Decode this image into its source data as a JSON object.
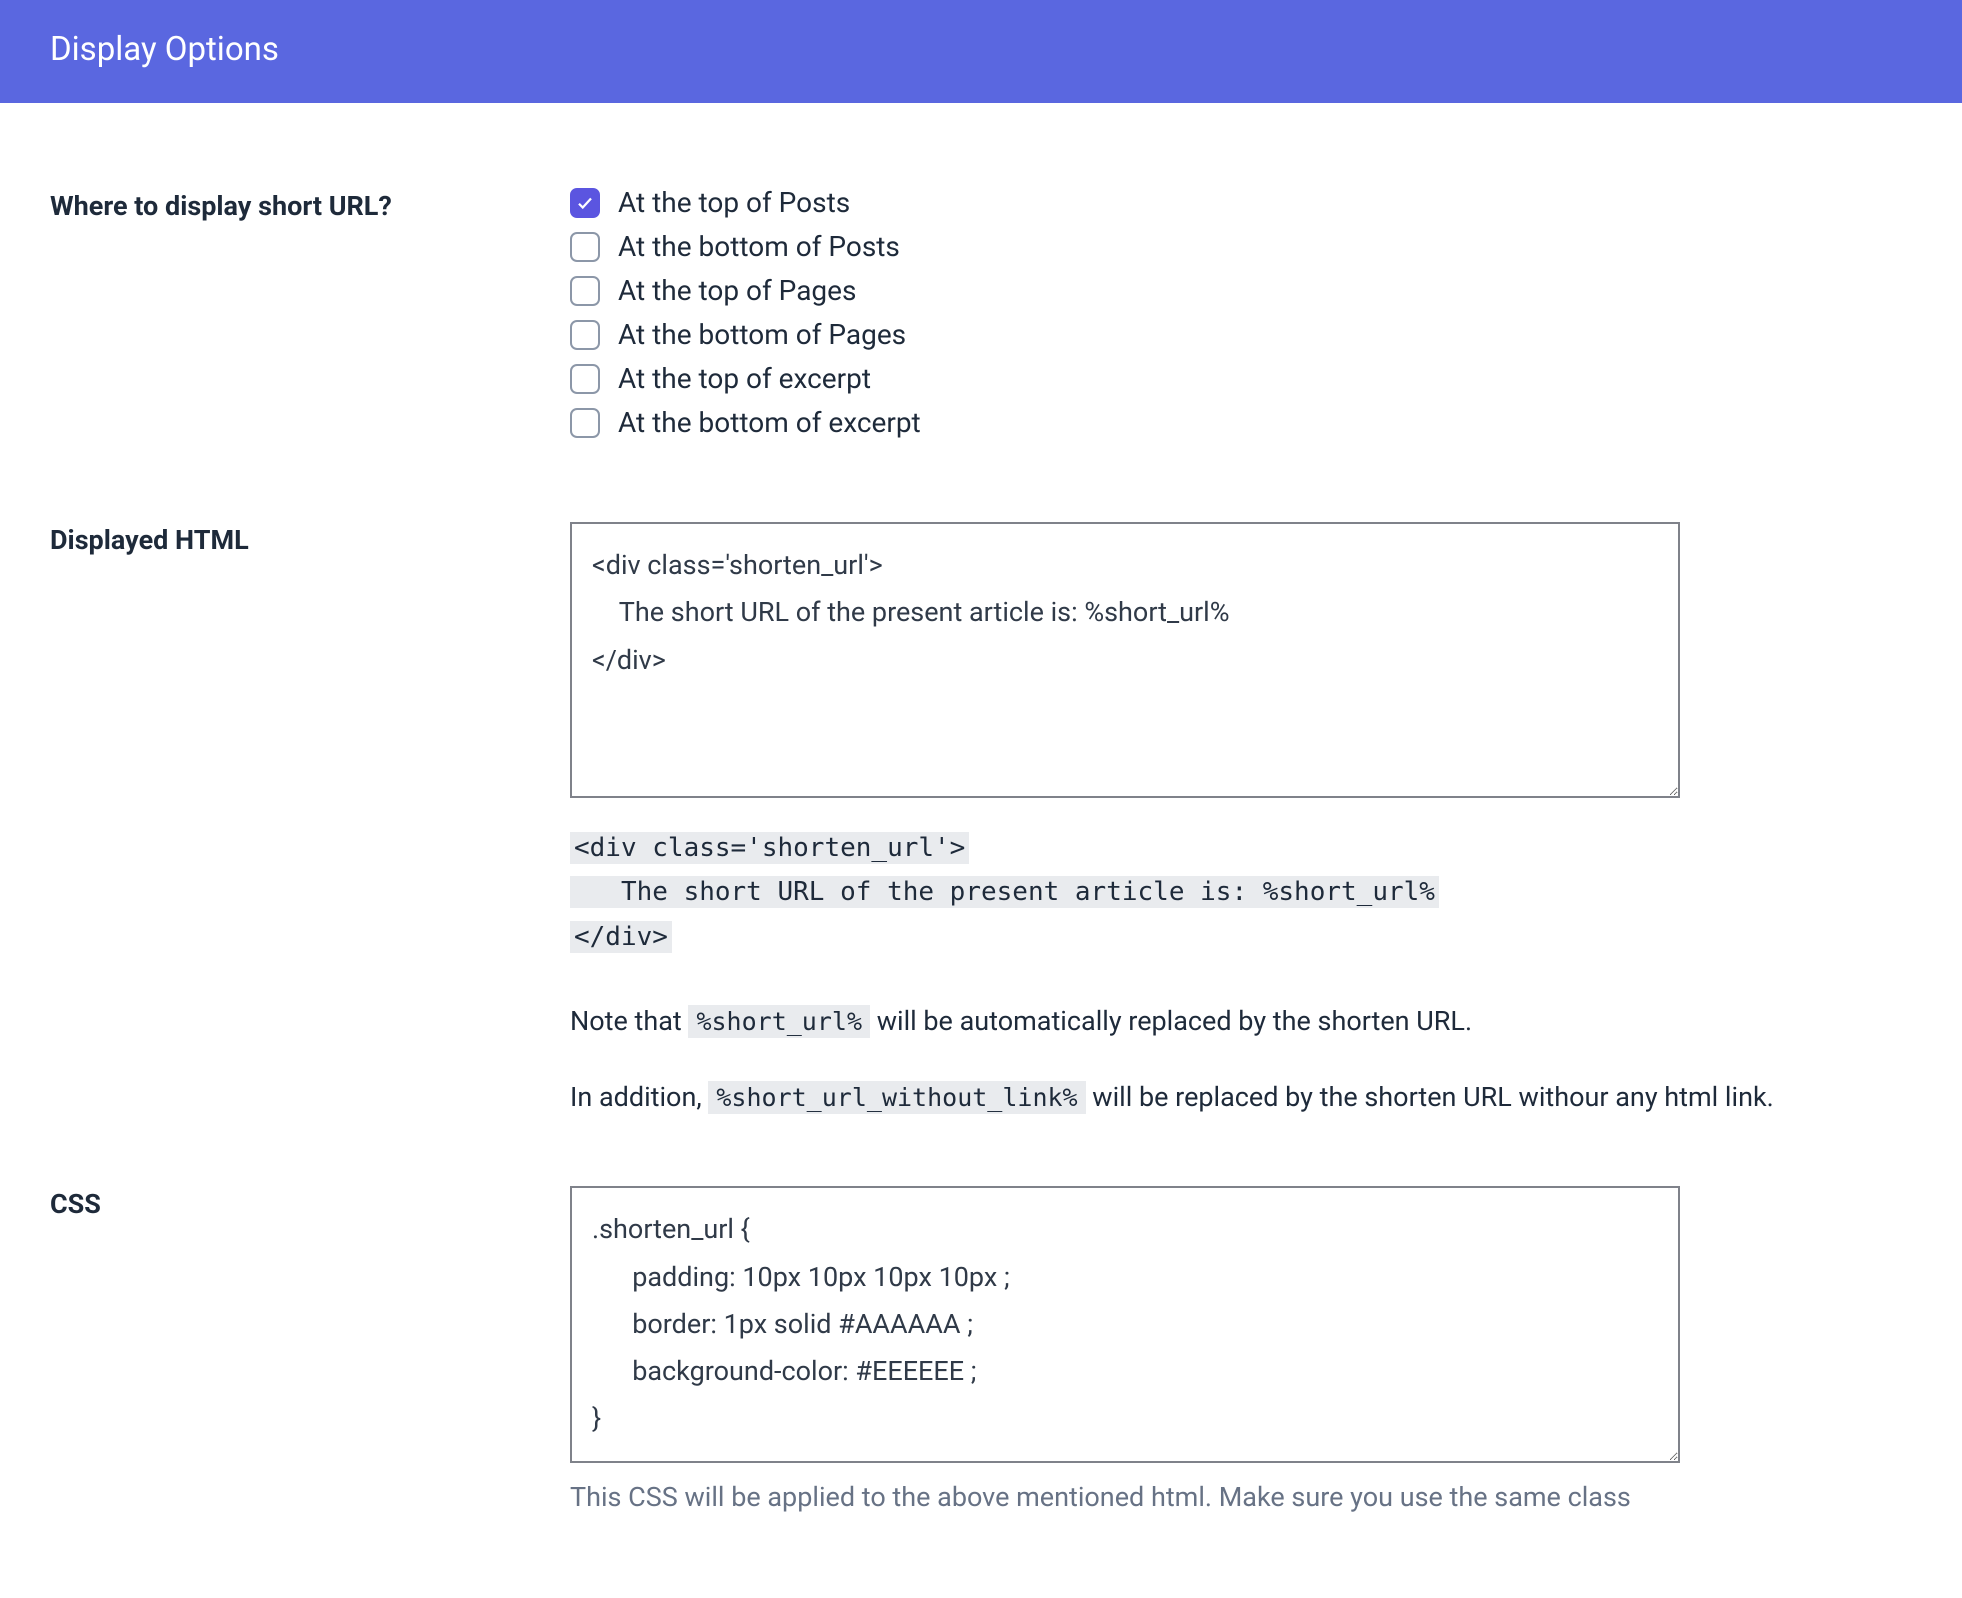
{
  "banner": {
    "title": "Display Options"
  },
  "sections": {
    "where": {
      "label": "Where to display short URL?",
      "options": [
        {
          "label": "At the top of Posts",
          "checked": true
        },
        {
          "label": "At the bottom of Posts",
          "checked": false
        },
        {
          "label": "At the top of Pages",
          "checked": false
        },
        {
          "label": "At the bottom of Pages",
          "checked": false
        },
        {
          "label": "At the top of excerpt",
          "checked": false
        },
        {
          "label": "At the bottom of excerpt",
          "checked": false
        }
      ]
    },
    "html": {
      "label": "Displayed HTML",
      "textarea_value": "<div class='shorten_url'>\n    The short URL of the present article is: %short_url%\n</div>",
      "code_sample_lines": [
        "<div class='shorten_url'>",
        "   The short URL of the present article is: %short_url%",
        "</div>"
      ],
      "note1_pre": "Note that ",
      "note1_code": "%short_url%",
      "note1_post": " will be automatically replaced by the shorten URL.",
      "note2_pre": "In addition, ",
      "note2_code": "%short_url_without_link%",
      "note2_post": " will be replaced by the shorten URL withour any html link."
    },
    "css": {
      "label": "CSS",
      "textarea_value": ".shorten_url {\n      padding: 10px 10px 10px 10px ;\n      border: 1px solid #AAAAAA ;\n      background-color: #EEEEEE ;\n}",
      "helper": "This CSS will be applied to the above mentioned html. Make sure you use the same class"
    }
  }
}
